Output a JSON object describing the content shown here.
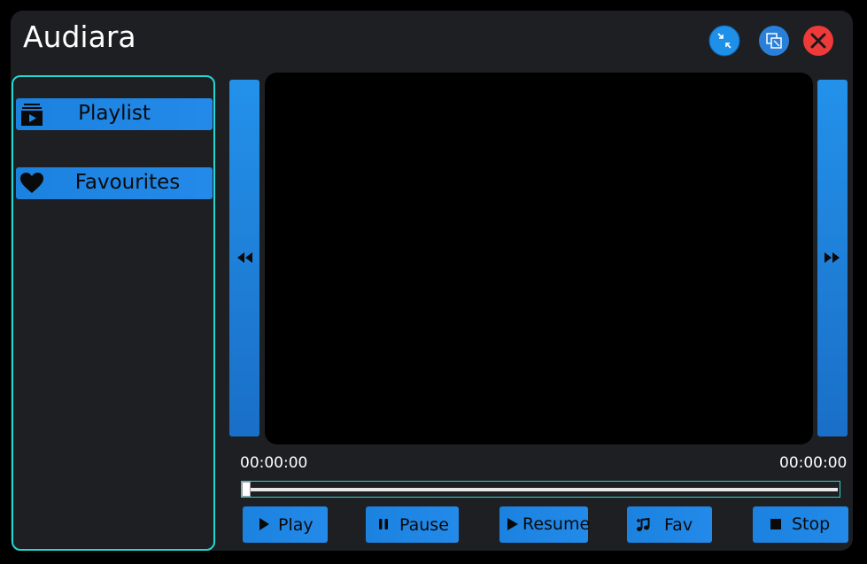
{
  "app": {
    "title": "Audiara"
  },
  "window_controls": {
    "minimize_color": "#1e90e8",
    "maximize_color": "#2a7fd9",
    "close_color": "#ef3a3a"
  },
  "sidebar": {
    "border_color": "#22d8d2",
    "items": [
      {
        "label": "Playlist",
        "icon": "playlist-play-icon"
      },
      {
        "label": "Favourites",
        "icon": "heart-icon"
      }
    ]
  },
  "player": {
    "previous_icon": "rewind-icon",
    "next_icon": "fast-forward-icon",
    "current_time": "00:00:00",
    "total_time": "00:00:00",
    "progress": 0
  },
  "controls": {
    "play_label": "Play",
    "pause_label": "Pause",
    "resume_label": "Resume",
    "fav_label": "Fav",
    "stop_label": "Stop"
  },
  "colors": {
    "accent": "#1e88e5",
    "background": "#1e1f22",
    "highlight": "#22d8d2"
  }
}
